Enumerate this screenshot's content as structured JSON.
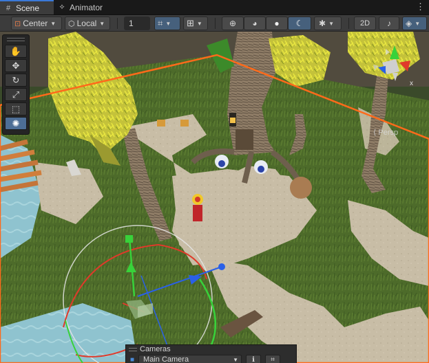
{
  "tabs": [
    {
      "label": "Scene",
      "icon": "grid-icon",
      "active": true
    },
    {
      "label": "Animator",
      "icon": "animator-icon",
      "active": false
    }
  ],
  "toolbar": {
    "pivot_label": "Center",
    "space_label": "Local",
    "grid_size_value": "1",
    "mode_2d_label": "2D"
  },
  "tools": [
    "hand-tool",
    "move-tool",
    "rotate-tool",
    "scale-tool",
    "rect-tool",
    "transform-tool"
  ],
  "orientation": {
    "projection_label": "Persp",
    "axis_x_label": "x"
  },
  "cameras": {
    "title": "Cameras",
    "selected_camera": "Main Camera"
  },
  "colors": {
    "accent": "#3a79d8",
    "selection_outline": "#ff6a1a",
    "gizmo_x": "#e03a2a",
    "gizmo_y": "#38d23a",
    "gizmo_z": "#2a60e8"
  }
}
